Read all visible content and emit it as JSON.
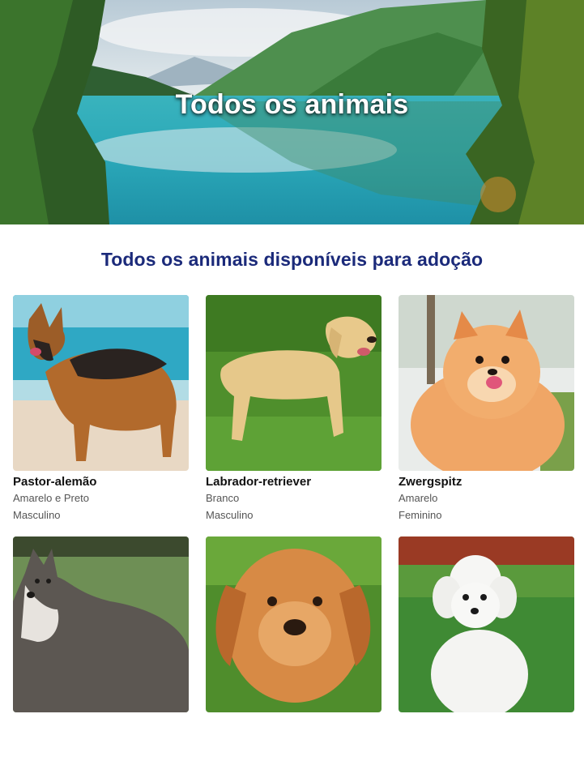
{
  "hero": {
    "title": "Todos os animais"
  },
  "section": {
    "title": "Todos os animais disponíveis para adoção"
  },
  "animals": [
    {
      "name": "Pastor-alemão",
      "color": "Amarelo e Preto",
      "sex": "Masculino"
    },
    {
      "name": "Labrador-retriever",
      "color": "Branco",
      "sex": "Masculino"
    },
    {
      "name": "Zwergspitz",
      "color": "Amarelo",
      "sex": "Feminino"
    },
    {
      "name": "",
      "color": "",
      "sex": ""
    },
    {
      "name": "",
      "color": "",
      "sex": ""
    },
    {
      "name": "",
      "color": "",
      "sex": ""
    }
  ]
}
